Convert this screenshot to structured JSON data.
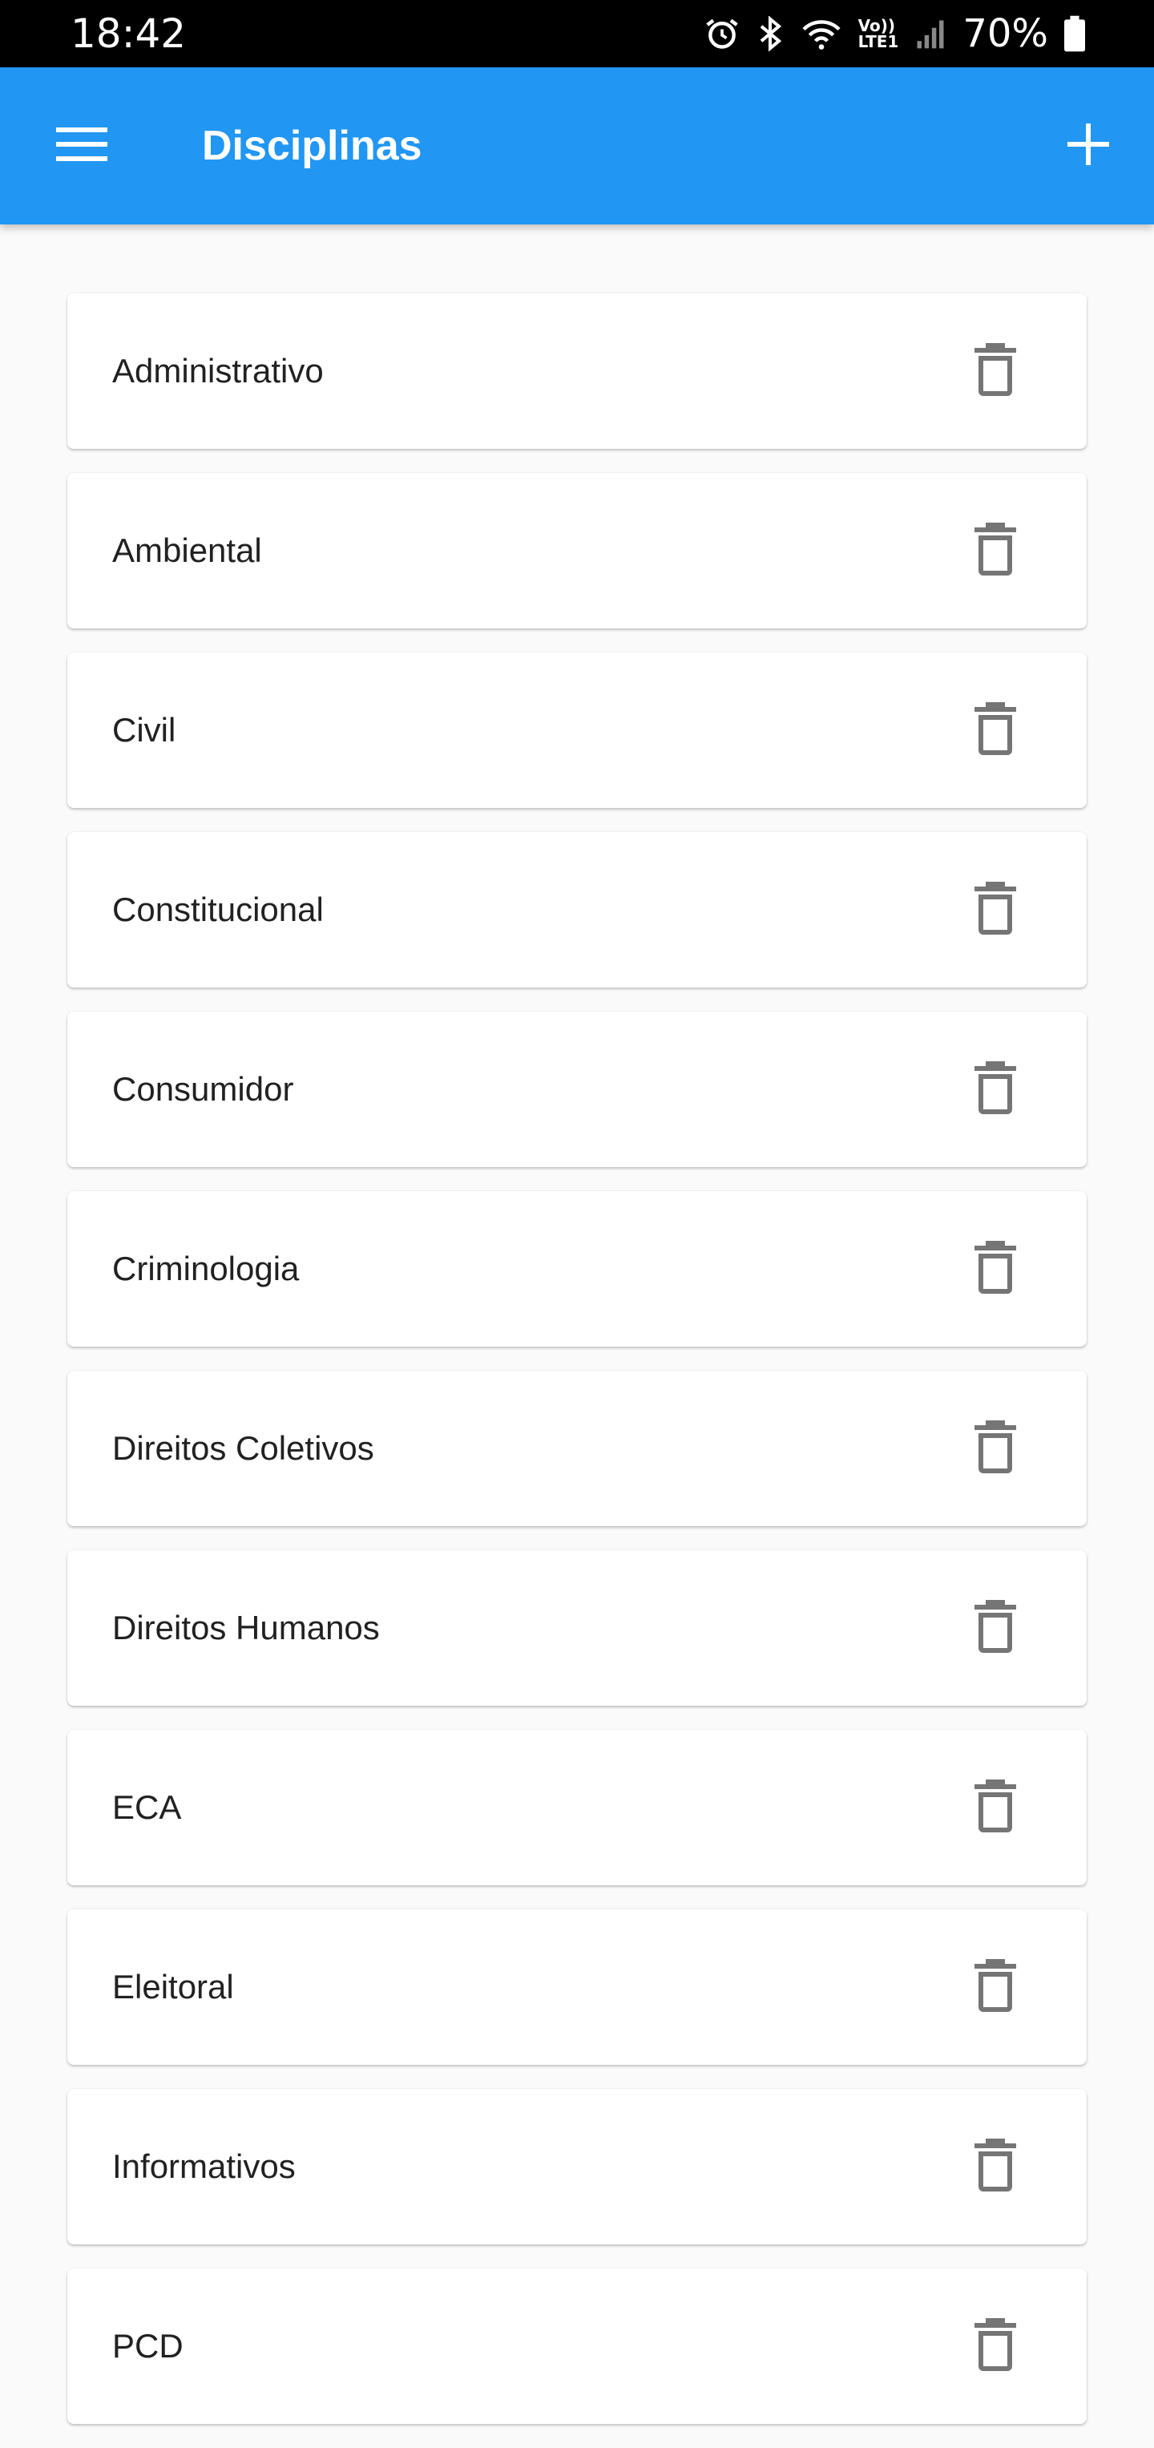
{
  "status_bar": {
    "time": "18:42",
    "battery": "70%",
    "icons": [
      "alarm-icon",
      "bluetooth-icon",
      "wifi-icon",
      "volte-lte-icon",
      "signal-icon",
      "battery-icon"
    ],
    "network_label_top": "Vo))",
    "network_label_bottom": "LTE1"
  },
  "app_bar": {
    "title": "Disciplinas",
    "background_color": "#2196f3",
    "menu_icon": "menu-icon",
    "add_icon": "plus-icon"
  },
  "disciplines": [
    {
      "label": "Administrativo",
      "action_icon": "trash-icon"
    },
    {
      "label": "Ambiental",
      "action_icon": "trash-icon"
    },
    {
      "label": "Civil",
      "action_icon": "trash-icon"
    },
    {
      "label": "Constitucional",
      "action_icon": "trash-icon"
    },
    {
      "label": "Consumidor",
      "action_icon": "trash-icon"
    },
    {
      "label": "Criminologia",
      "action_icon": "trash-icon"
    },
    {
      "label": "Direitos Coletivos",
      "action_icon": "trash-icon"
    },
    {
      "label": "Direitos Humanos",
      "action_icon": "trash-icon"
    },
    {
      "label": "ECA",
      "action_icon": "trash-icon"
    },
    {
      "label": "Eleitoral",
      "action_icon": "trash-icon"
    },
    {
      "label": "Informativos",
      "action_icon": "trash-icon"
    },
    {
      "label": "PCD",
      "action_icon": "trash-icon"
    }
  ]
}
